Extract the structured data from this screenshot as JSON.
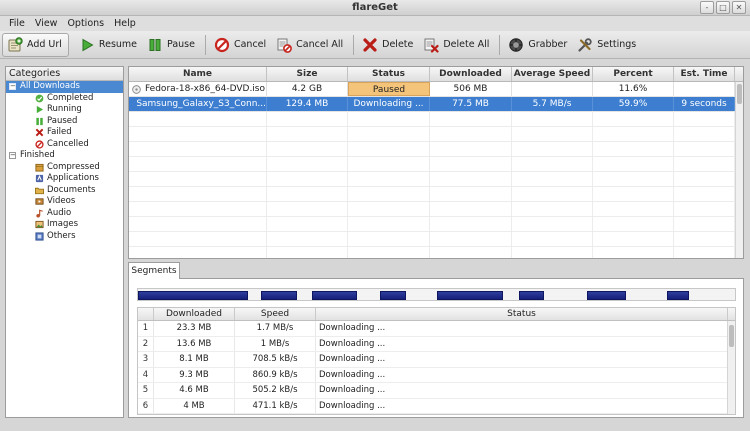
{
  "window": {
    "title": "flareGet",
    "buttons": [
      "-",
      "□",
      "✕"
    ]
  },
  "menu": [
    "File",
    "View",
    "Options",
    "Help"
  ],
  "toolbar": {
    "add_url": "Add Url",
    "resume": "Resume",
    "pause": "Pause",
    "cancel": "Cancel",
    "cancel_all": "Cancel All",
    "delete": "Delete",
    "delete_all": "Delete All",
    "grabber": "Grabber",
    "settings": "Settings"
  },
  "sidebar": {
    "header": "Categories",
    "items": [
      {
        "label": "All Downloads",
        "icon": "expand-minus",
        "level": 0,
        "selected": true
      },
      {
        "label": "Completed",
        "icon": "check-icon",
        "level": 1
      },
      {
        "label": "Running",
        "icon": "play-icon",
        "level": 1
      },
      {
        "label": "Paused",
        "icon": "pause-icon",
        "level": 1
      },
      {
        "label": "Failed",
        "icon": "x-icon",
        "level": 1
      },
      {
        "label": "Cancelled",
        "icon": "cancel-icon",
        "level": 1
      },
      {
        "label": "Finished",
        "icon": "expand-minus",
        "level": 0
      },
      {
        "label": "Compressed",
        "icon": "archive-icon",
        "level": 1
      },
      {
        "label": "Applications",
        "icon": "app-icon",
        "level": 1
      },
      {
        "label": "Documents",
        "icon": "folder-icon",
        "level": 1
      },
      {
        "label": "Videos",
        "icon": "video-icon",
        "level": 1
      },
      {
        "label": "Audio",
        "icon": "audio-icon",
        "level": 1
      },
      {
        "label": "Images",
        "icon": "image-icon",
        "level": 1
      },
      {
        "label": "Others",
        "icon": "other-icon",
        "level": 1
      }
    ]
  },
  "downloads": {
    "columns": [
      "Name",
      "Size",
      "Status",
      "Downloaded",
      "Average Speed",
      "Percent",
      "Est. Time"
    ],
    "rows": [
      {
        "name": "Fedora-18-x86_64-DVD.iso",
        "size": "4.2 GB",
        "status": "Paused",
        "downloaded": "506 MB",
        "speed": "",
        "percent": "11.6%",
        "eta": ""
      },
      {
        "name": "Samsung_Galaxy_S3_Conn...",
        "size": "129.4 MB",
        "status": "Downloading ...",
        "downloaded": "77.5 MB",
        "speed": "5.7 MB/s",
        "percent": "59.9%",
        "eta": "9 seconds"
      }
    ]
  },
  "segments": {
    "tab_label": "Segments",
    "columns": [
      "",
      "Downloaded",
      "Speed",
      "Status"
    ],
    "rows": [
      {
        "index": "1",
        "downloaded": "23.3 MB",
        "speed": "1.7 MB/s",
        "status": "Downloading ..."
      },
      {
        "index": "2",
        "downloaded": "13.6 MB",
        "speed": "1 MB/s",
        "status": "Downloading ..."
      },
      {
        "index": "3",
        "downloaded": "8.1 MB",
        "speed": "708.5 kB/s",
        "status": "Downloading ..."
      },
      {
        "index": "4",
        "downloaded": "9.3 MB",
        "speed": "860.9 kB/s",
        "status": "Downloading ..."
      },
      {
        "index": "5",
        "downloaded": "4.6 MB",
        "speed": "505.2 kB/s",
        "status": "Downloading ..."
      },
      {
        "index": "6",
        "downloaded": "4 MB",
        "speed": "471.1 kB/s",
        "status": "Downloading ..."
      }
    ]
  },
  "colors": {
    "selection": "#3d7ed0",
    "paused": "#f4c47a",
    "segment": "#1f2b8a"
  }
}
